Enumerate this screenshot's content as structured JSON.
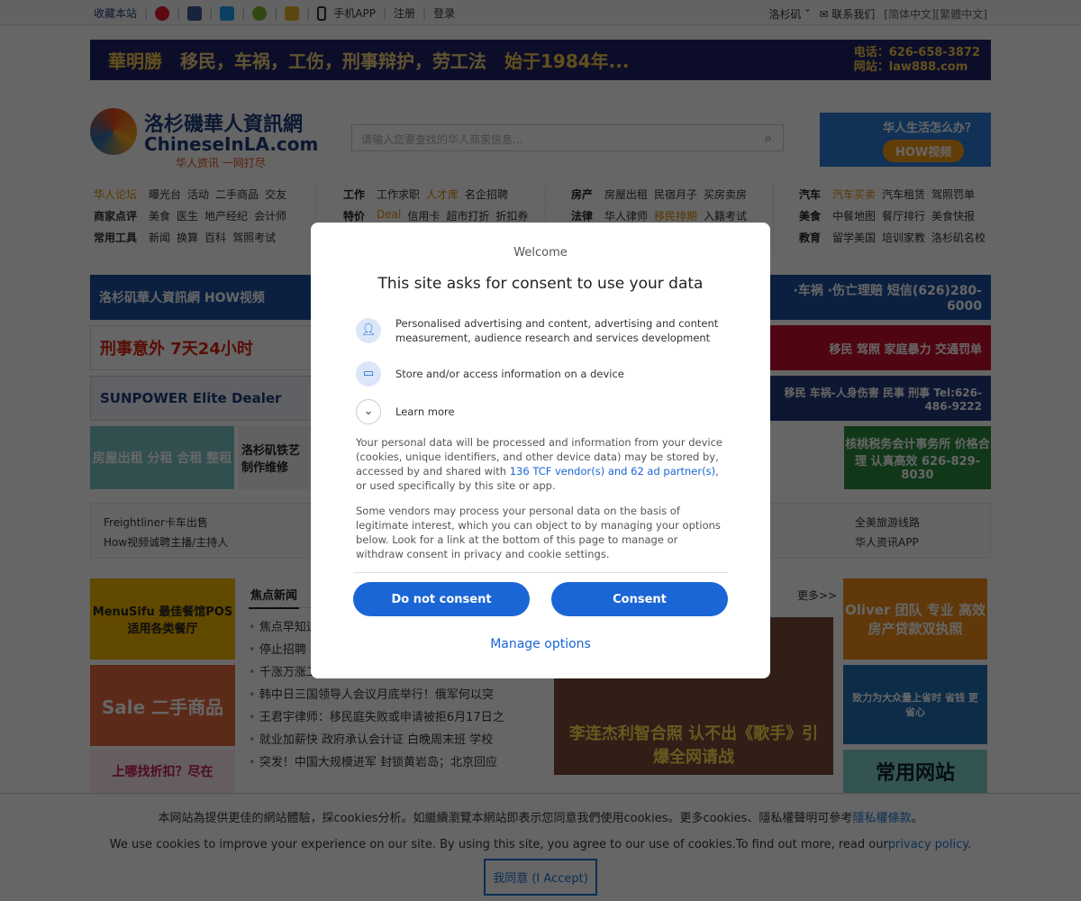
{
  "topbar": {
    "favorite": "收藏本站",
    "mobile_app": "手机APP",
    "register": "注册",
    "login": "登录",
    "city": "洛杉矶",
    "contact": "联系我们",
    "lang": "[简体中文][繁體中文]"
  },
  "banner": {
    "brand": "華明勝",
    "slogan": "移民，车祸，工伤，刑事辩护，劳工法",
    "since": "始于1984年...",
    "phone": "电话：626-658-3872",
    "site": "网站：law888.com"
  },
  "logo": {
    "cn": "洛杉磯華人資訊網",
    "en": "ChineseInLA.com",
    "tagline": "华人资讯 一网打尽"
  },
  "search": {
    "placeholder": "请输入您要查找的华人商家信息..."
  },
  "right_ad": {
    "q": "华人生活怎么办？",
    "btn": "HOW视频"
  },
  "nav": [
    [
      [
        "华人论坛",
        "曝光台",
        "活动",
        "二手商品",
        "交友"
      ],
      [
        "商家点评",
        "美食",
        "医生",
        "地产经纪",
        "会计师"
      ],
      [
        "常用工具",
        "新闻",
        "换算",
        "百科",
        "驾照考试"
      ]
    ],
    [
      [
        "工作",
        "工作求职",
        "人才库",
        "名企招聘"
      ],
      [
        "特价",
        "Deal",
        "信用卡",
        "超市打折",
        "折扣券"
      ],
      [
        "",
        "",
        "",
        "",
        ""
      ]
    ],
    [
      [
        "房产",
        "房屋出租",
        "民宿月子",
        "买房卖房"
      ],
      [
        "法律",
        "华人律师",
        "移民排期",
        "入籍考试"
      ],
      [
        "",
        "",
        "",
        ""
      ]
    ],
    [
      [
        "汽车",
        "汽车买卖",
        "汽车租赁",
        "驾照罚单"
      ],
      [
        "美食",
        "中餐地图",
        "餐厅排行",
        "美食快报"
      ],
      [
        "教育",
        "留学美国",
        "培训家教",
        "洛杉矶名校"
      ]
    ]
  ],
  "ads": {
    "a1": "洛杉矶華人資訊網 HOW视频",
    "a2": "刑事意外 7天24小时",
    "a3": "SUNPOWER Elite Dealer",
    "a4": "房屋出租 分租 合租 整租",
    "a5": "洛杉矶铁艺 制作维修",
    "r1": "·车祸 ·伤亡理赔 短信(626)280-6000",
    "r2": "移民 驾照 家庭暴力 交通罚单",
    "r3": "移民 车祸-人身伤害 民事 刑事 Tel:626-486-9222",
    "r4": "核桃税务会计事务所 价格合理 认真高效 626-829-8030"
  },
  "links": {
    "c1": [
      "Freightliner卡车出售",
      "How视频诚聘主播/主持人"
    ],
    "c4": [
      "全美旅游线路",
      "华人资讯APP"
    ]
  },
  "left_ads": {
    "menusifu": "MenuSifu 最佳餐馆POS适用各类餐厅",
    "sale": "Sale 二手商品",
    "discount": "上哪找折扣？尽在"
  },
  "news": {
    "tab": "焦点新闻",
    "more": "更多>>",
    "items": [
      "焦点早知道",
      "停止招聘",
      "千涨万涨工资不涨 8向年0首付买陷阱",
      "韩中日三国领导人会议月底举行！俄军何以突",
      "王君宇律师：移民庭失败或申请被拒6月17日之",
      "就业加薪快 政府承认会计证 白晚周末班 学校",
      "突发！中国大规模进军 封锁黄岩岛；北京回应"
    ]
  },
  "photo": {
    "caption": "李连杰利智合照 认不出《歌手》引爆全网请战"
  },
  "right_col": {
    "oliver": "Oliver 团队 专业 高效 房产贷款双执照",
    "delivery": "致力为大众量上省时 省钱 更省心",
    "common": "常用网站"
  },
  "cookie": {
    "cn": "本网站為提供更佳的網站體驗，採cookies分析。如繼續瀏覽本網站即表示您同意我們使用cookies。更多cookies、隱私權聲明可參考",
    "cn_link": "隱私權條款",
    "cn_end": "。",
    "en": "We use cookies to improve your experience on our site. By using this site, you agree to our use of cookies.To find out more, read our",
    "en_link": "privacy policy",
    "en_end": ".",
    "accept": "我同意 (I Accept)"
  },
  "consent": {
    "welcome": "Welcome",
    "title": "This site asks for consent to use your data",
    "purpose1": "Personalised advertising and content, advertising and content measurement, audience research and services development",
    "purpose2": "Store and/or access information on a device",
    "learn_more": "Learn more",
    "p1_a": "Your personal data will be processed and information from your device (cookies, unique identifiers, and other device data) may be stored by, accessed by and shared with ",
    "p1_link": "136 TCF vendor(s) and 62 ad partner(s)",
    "p1_b": ", or used specifically by this site or app.",
    "p2": "Some vendors may process your personal data on the basis of legitimate interest, which you can object to by managing your options below. Look for a link at the bottom of this page to manage or withdraw consent in privacy and cookie settings.",
    "do_not_consent": "Do not consent",
    "consent": "Consent",
    "manage": "Manage options"
  },
  "colors": {
    "accent": "#1a66d6",
    "orange": "#e08a00"
  }
}
